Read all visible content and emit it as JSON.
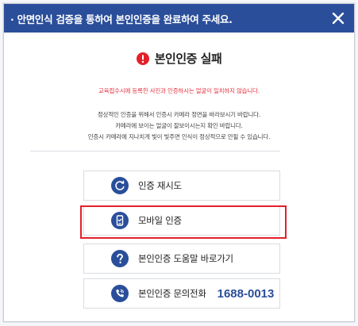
{
  "modal": {
    "title": "· 안면인식 검증을 통하여 본인인증을 완료하여 주세요.",
    "status_text": "본인인증 실패",
    "error_message": "교육접수시에 등록한 사진과 인증하시는 얼굴이 일치하지 않습니다.",
    "guide_lines": [
      "정상적인 인증을 위해서 인증시 카메라 정면을 바라보시기 바랍니다.",
      "카메라에 보이는 얼굴이 잘보이시는지 확인 바랍니다.",
      "인증시 카메라에 지나치게 빛이 빛주면 인식이 정상적으로 안될 수 있습니다."
    ]
  },
  "options": [
    {
      "label": "인증 재시도",
      "icon": "retry-icon"
    },
    {
      "label": "모바일 인증",
      "icon": "mobile-icon"
    },
    {
      "label": "본인인증 도움말 바로가기",
      "icon": "question-icon"
    },
    {
      "label": "본인인증 문의전화",
      "phone": "1688-0013",
      "icon": "phone-icon"
    }
  ],
  "colors": {
    "header_bg": "#2a4e9a",
    "icon_bg": "#2a4e9a",
    "error_text": "#e53340",
    "highlight_border": "#e3202a"
  }
}
